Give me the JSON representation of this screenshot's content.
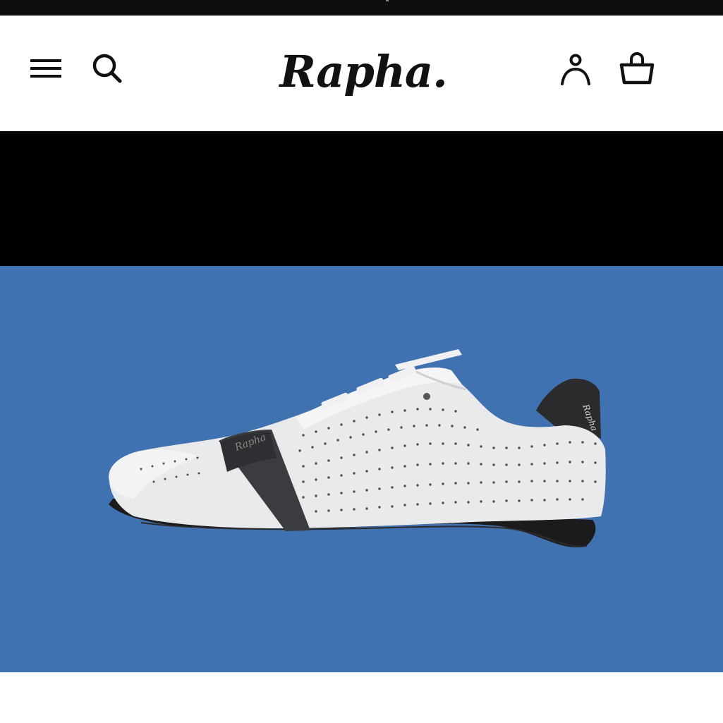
{
  "header": {
    "brand_name": "Rapha.",
    "icons": {
      "menu": "hamburger-menu-icon",
      "search": "search-icon",
      "account": "user-account-icon",
      "basket": "basket-icon"
    }
  },
  "hero": {
    "image": "white-cycling-shoe-with-black-strap",
    "background_color": "#4071b0"
  },
  "colors": {
    "status_bar": "#0d0d0d",
    "header_bg": "#ffffff",
    "band": "#000000",
    "icon": "#111111"
  }
}
